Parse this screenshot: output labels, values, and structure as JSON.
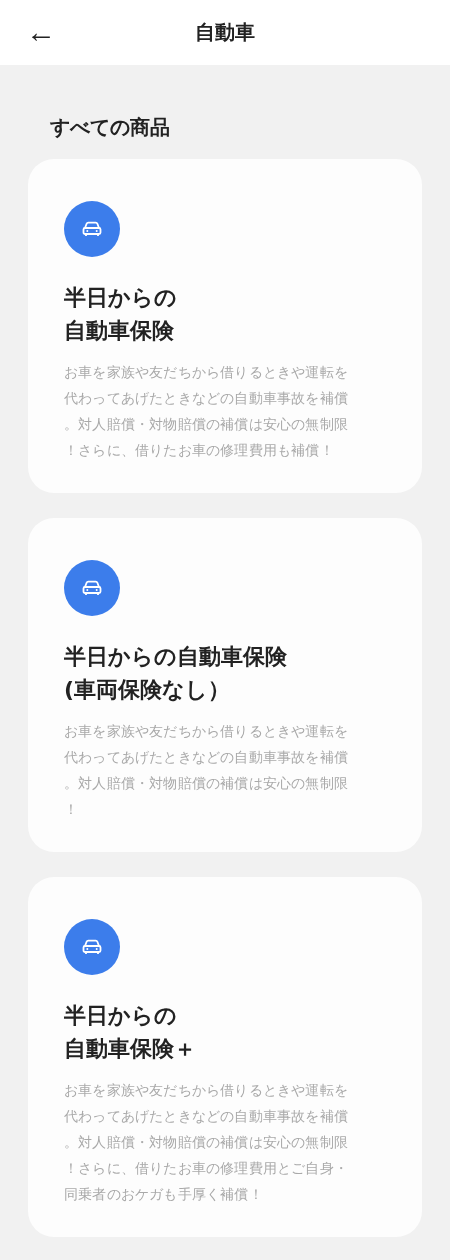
{
  "header": {
    "back": "←",
    "title": "自動車"
  },
  "section_title": "すべての商品",
  "products": [
    {
      "title_lines": [
        "半日からの",
        "自動車保険"
      ],
      "description": "お車を家族や友だちから借りるときや運転を代わってあげたときなどの自動車事故を補償。対人賠償・対物賠償の補償は安心の無制限！さらに、借りたお車の修理費用も補償！"
    },
    {
      "title_lines": [
        "半日からの自動車保険",
        "(車両保険なし）"
      ],
      "description": "お車を家族や友だちから借りるときや運転を代わってあげたときなどの自動車事故を補償。対人賠償・対物賠償の補償は安心の無制限！"
    },
    {
      "title_lines": [
        "半日からの",
        "自動車保険＋"
      ],
      "description": "お車を家族や友だちから借りるときや運転を代わってあげたときなどの自動車事故を補償。対人賠償・対物賠償の補償は安心の無制限！さらに、借りたお車の修理費用とご自身・同乗者のおケガも手厚く補償！"
    }
  ]
}
